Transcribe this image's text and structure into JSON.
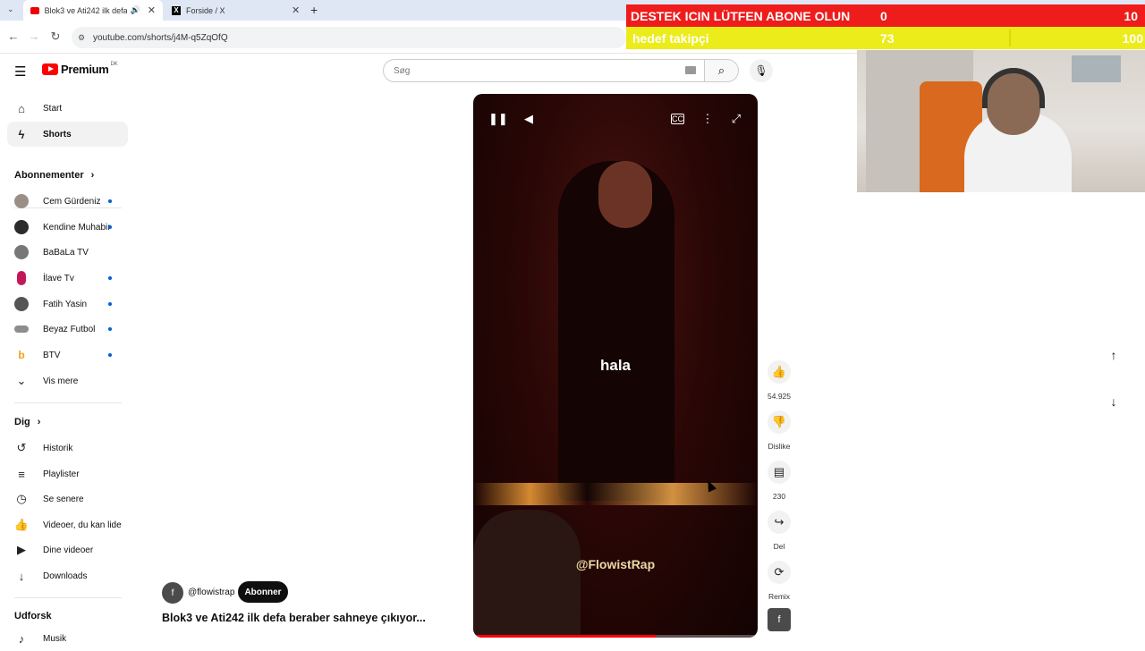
{
  "browser": {
    "tabs": [
      {
        "label": "Blok3 ve Ati242 ilk defa be"
      },
      {
        "label": "Forside / X"
      }
    ],
    "url": "youtube.com/shorts/j4M-q5ZqOfQ"
  },
  "overlay": {
    "row1_label": "DESTEK ICIN LÜTFEN ABONE OLUN",
    "row1_value": "0",
    "row1_goal": "10",
    "row2_label": "hedef takipçi",
    "row2_value": "73",
    "row2_goal": "100",
    "colors": {
      "row1": "#ef1c1c",
      "row2": "#ecec1a"
    }
  },
  "header": {
    "brand": "Premium",
    "brand_region": "DK",
    "search_placeholder": "Søg"
  },
  "sidebar": {
    "main": [
      {
        "label": "Start",
        "icon": "home-icon"
      },
      {
        "label": "Shorts",
        "icon": "shorts-icon"
      }
    ],
    "subs_heading": "Abonnementer",
    "subscriptions": [
      {
        "label": "Cem Gürdeniz",
        "color": "#9a8f86"
      },
      {
        "label": "Kendine Muhabir",
        "color": "#2b2b2b"
      },
      {
        "label": "BaBaLa TV",
        "color": "#777"
      },
      {
        "label": "İlave Tv",
        "color": "#c2185b"
      },
      {
        "label": "Fatih Yasin",
        "color": "#555"
      },
      {
        "label": "Beyaz Futbol",
        "color": "#8d8d8d"
      },
      {
        "label": "BTV",
        "color": "#f0a020"
      }
    ],
    "show_more": "Vis mere",
    "you_heading": "Dig",
    "you_items": [
      {
        "label": "Historik",
        "icon": "history-icon"
      },
      {
        "label": "Playlister",
        "icon": "playlist-icon"
      },
      {
        "label": "Se senere",
        "icon": "clock-icon"
      },
      {
        "label": "Videoer, du kan lide",
        "icon": "thumbs-up-icon"
      },
      {
        "label": "Dine videoer",
        "icon": "video-icon"
      },
      {
        "label": "Downloads",
        "icon": "download-icon"
      }
    ],
    "explore_heading": "Udforsk",
    "explore_items": [
      {
        "label": "Musik",
        "icon": "music-icon"
      }
    ]
  },
  "video": {
    "caption": "hala",
    "watermark": "@FlowistRap",
    "progress": 0.64,
    "channel_initial": "f",
    "channel_handle": "@flowistrap",
    "subscribe_label": "Abonner",
    "title": "Blok3 ve Ati242 ilk defa beraber sahneye çıkıyor..."
  },
  "actions": {
    "likes": "54.925",
    "dislike": "Dislike",
    "comments": "230",
    "share": "Del",
    "remix": "Remix"
  }
}
